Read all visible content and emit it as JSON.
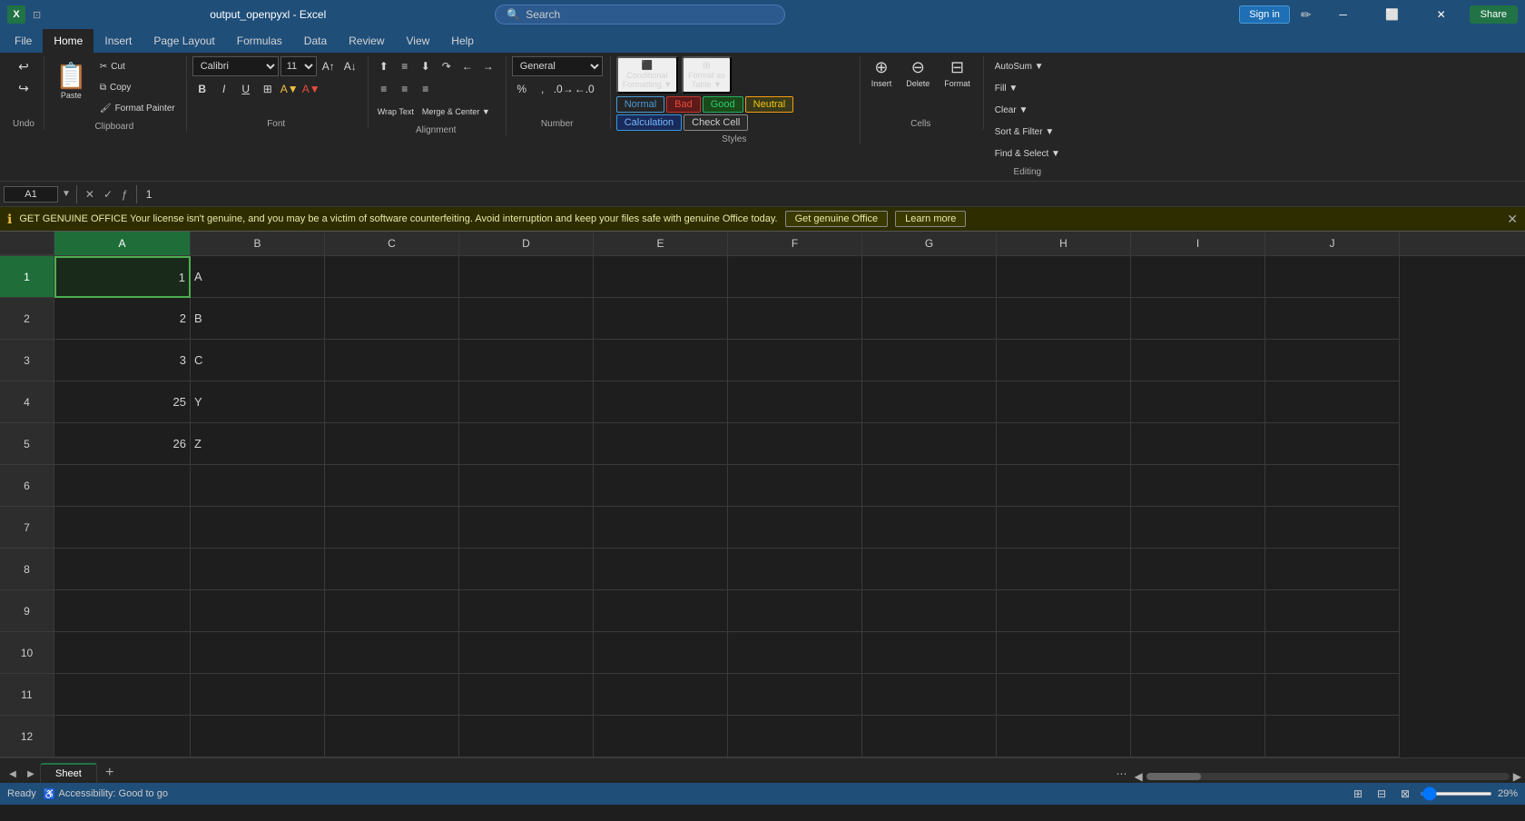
{
  "titleBar": {
    "appIcon": "X",
    "fileTitle": "output_openpyxl - Excel",
    "searchPlaceholder": "Search",
    "signinLabel": "Sign in",
    "shareLabel": "Share",
    "editIconLabel": "✏"
  },
  "ribbon": {
    "tabs": [
      "File",
      "Home",
      "Insert",
      "Page Layout",
      "Formulas",
      "Data",
      "Review",
      "View",
      "Help"
    ],
    "activeTab": "Home"
  },
  "groups": {
    "undo": {
      "label": "Undo"
    },
    "clipboard": {
      "label": "Clipboard",
      "pasteLabel": "Paste",
      "cutLabel": "Cut",
      "copyLabel": "Copy",
      "formatPainterLabel": "Format Painter"
    },
    "font": {
      "label": "Font",
      "fontName": "Calibri",
      "fontSize": "11",
      "boldLabel": "B",
      "italicLabel": "I",
      "underlineLabel": "U",
      "fontGrowLabel": "A↑",
      "fontShrinkLabel": "A↓"
    },
    "alignment": {
      "label": "Alignment",
      "wrapTextLabel": "Wrap Text",
      "mergeCenterLabel": "Merge & Center ▼"
    },
    "number": {
      "label": "Number",
      "formatLabel": "General"
    },
    "styles": {
      "label": "Styles",
      "normalLabel": "Normal",
      "badLabel": "Bad",
      "goodLabel": "Good",
      "neutralLabel": "Neutral",
      "calculationLabel": "Calculation",
      "checkCellLabel": "Check Cell"
    },
    "cells": {
      "label": "Cells",
      "insertLabel": "Insert",
      "deleteLabel": "Delete",
      "formatLabel": "Format"
    },
    "editing": {
      "label": "Editing",
      "autoSumLabel": "AutoSum ▼",
      "fillLabel": "Fill ▼",
      "clearLabel": "Clear ▼",
      "sortFilterLabel": "Sort & Filter ▼",
      "findSelectLabel": "Find & Select ▼"
    }
  },
  "formulaBar": {
    "cellRef": "A1",
    "formula": "1"
  },
  "notifBar": {
    "message": "GET GENUINE OFFICE  Your license isn't genuine, and you may be a victim of software counterfeiting. Avoid interruption and keep your files safe with genuine Office today.",
    "btn1": "Get genuine Office",
    "btn2": "Learn more"
  },
  "columns": [
    "A",
    "B",
    "C",
    "D",
    "E",
    "F",
    "G",
    "H",
    "I",
    "J"
  ],
  "rows": [
    {
      "id": 1,
      "a": "1",
      "b": "A"
    },
    {
      "id": 2,
      "a": "2",
      "b": "B"
    },
    {
      "id": 3,
      "a": "3",
      "b": "C"
    },
    {
      "id": 4,
      "a": "25",
      "b": "Y"
    },
    {
      "id": 5,
      "a": "26",
      "b": "Z"
    },
    {
      "id": 6,
      "a": "",
      "b": ""
    },
    {
      "id": 7,
      "a": "",
      "b": ""
    },
    {
      "id": 8,
      "a": "",
      "b": ""
    },
    {
      "id": 9,
      "a": "",
      "b": ""
    },
    {
      "id": 10,
      "a": "",
      "b": ""
    },
    {
      "id": 11,
      "a": "",
      "b": ""
    },
    {
      "id": 12,
      "a": "",
      "b": ""
    }
  ],
  "sheetTabs": {
    "tabs": [
      "Sheet"
    ],
    "activeTab": "Sheet"
  },
  "statusBar": {
    "status": "Ready",
    "accessibility": "Accessibility: Good to go",
    "zoom": "29%"
  }
}
